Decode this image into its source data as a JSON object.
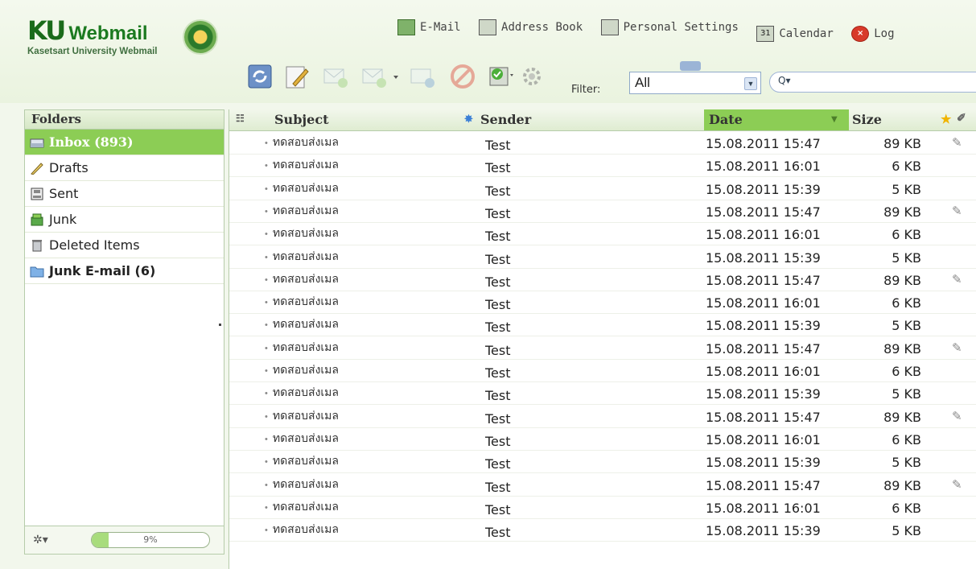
{
  "app": {
    "logo_ku": "KU",
    "logo_name": "Webmail",
    "logo_subtitle": "Kasetsart University Webmail"
  },
  "topnav": {
    "email": "E-Mail",
    "address_book": "Address Book",
    "personal_settings": "Personal Settings",
    "calendar": "Calendar",
    "calendar_icon_text": "31",
    "logout": "Log"
  },
  "toolbar": {
    "filter_label": "Filter:",
    "filter_value": "All",
    "search_placeholder": ""
  },
  "folders": {
    "header": "Folders",
    "items": [
      {
        "label": "Inbox (893)",
        "icon": "inbox-icon"
      },
      {
        "label": "Drafts",
        "icon": "pencil-icon"
      },
      {
        "label": "Sent",
        "icon": "sent-icon"
      },
      {
        "label": "Junk",
        "icon": "junk-icon"
      },
      {
        "label": "Deleted Items",
        "icon": "trash-icon"
      },
      {
        "label": "Junk E-mail (6)",
        "icon": "folder-icon"
      }
    ],
    "quota_text": "9%",
    "quota_fraction": 0.09
  },
  "list": {
    "headers": {
      "subject": "Subject",
      "sender": "Sender",
      "date": "Date",
      "size": "Size"
    },
    "rows": [
      {
        "subject": "ทดสอบส่งเมล",
        "sender": "Test",
        "date": "15.08.2011 15:47",
        "size": "89 KB",
        "attach": true
      },
      {
        "subject": "ทดสอบส่งเมล",
        "sender": "Test",
        "date": "15.08.2011 16:01",
        "size": "6 KB",
        "attach": false
      },
      {
        "subject": "ทดสอบส่งเมล",
        "sender": "Test",
        "date": "15.08.2011 15:39",
        "size": "5 KB",
        "attach": false
      },
      {
        "subject": "ทดสอบส่งเมล",
        "sender": "Test",
        "date": "15.08.2011 15:47",
        "size": "89 KB",
        "attach": true
      },
      {
        "subject": "ทดสอบส่งเมล",
        "sender": "Test",
        "date": "15.08.2011 16:01",
        "size": "6 KB",
        "attach": false
      },
      {
        "subject": "ทดสอบส่งเมล",
        "sender": "Test",
        "date": "15.08.2011 15:39",
        "size": "5 KB",
        "attach": false
      },
      {
        "subject": "ทดสอบส่งเมล",
        "sender": "Test",
        "date": "15.08.2011 15:47",
        "size": "89 KB",
        "attach": true
      },
      {
        "subject": "ทดสอบส่งเมล",
        "sender": "Test",
        "date": "15.08.2011 16:01",
        "size": "6 KB",
        "attach": false
      },
      {
        "subject": "ทดสอบส่งเมล",
        "sender": "Test",
        "date": "15.08.2011 15:39",
        "size": "5 KB",
        "attach": false
      },
      {
        "subject": "ทดสอบส่งเมล",
        "sender": "Test",
        "date": "15.08.2011 15:47",
        "size": "89 KB",
        "attach": true
      },
      {
        "subject": "ทดสอบส่งเมล",
        "sender": "Test",
        "date": "15.08.2011 16:01",
        "size": "6 KB",
        "attach": false
      },
      {
        "subject": "ทดสอบส่งเมล",
        "sender": "Test",
        "date": "15.08.2011 15:39",
        "size": "5 KB",
        "attach": false
      },
      {
        "subject": "ทดสอบส่งเมล",
        "sender": "Test",
        "date": "15.08.2011 15:47",
        "size": "89 KB",
        "attach": true
      },
      {
        "subject": "ทดสอบส่งเมล",
        "sender": "Test",
        "date": "15.08.2011 16:01",
        "size": "6 KB",
        "attach": false
      },
      {
        "subject": "ทดสอบส่งเมล",
        "sender": "Test",
        "date": "15.08.2011 15:39",
        "size": "5 KB",
        "attach": false
      },
      {
        "subject": "ทดสอบส่งเมล",
        "sender": "Test",
        "date": "15.08.2011 15:47",
        "size": "89 KB",
        "attach": true
      },
      {
        "subject": "ทดสอบส่งเมล",
        "sender": "Test",
        "date": "15.08.2011 16:01",
        "size": "6 KB",
        "attach": false
      },
      {
        "subject": "ทดสอบส่งเมล",
        "sender": "Test",
        "date": "15.08.2011 15:39",
        "size": "5 KB",
        "attach": false
      }
    ]
  },
  "colors": {
    "accent_green": "#8ccd55",
    "brand_green": "#1a6b1a"
  }
}
